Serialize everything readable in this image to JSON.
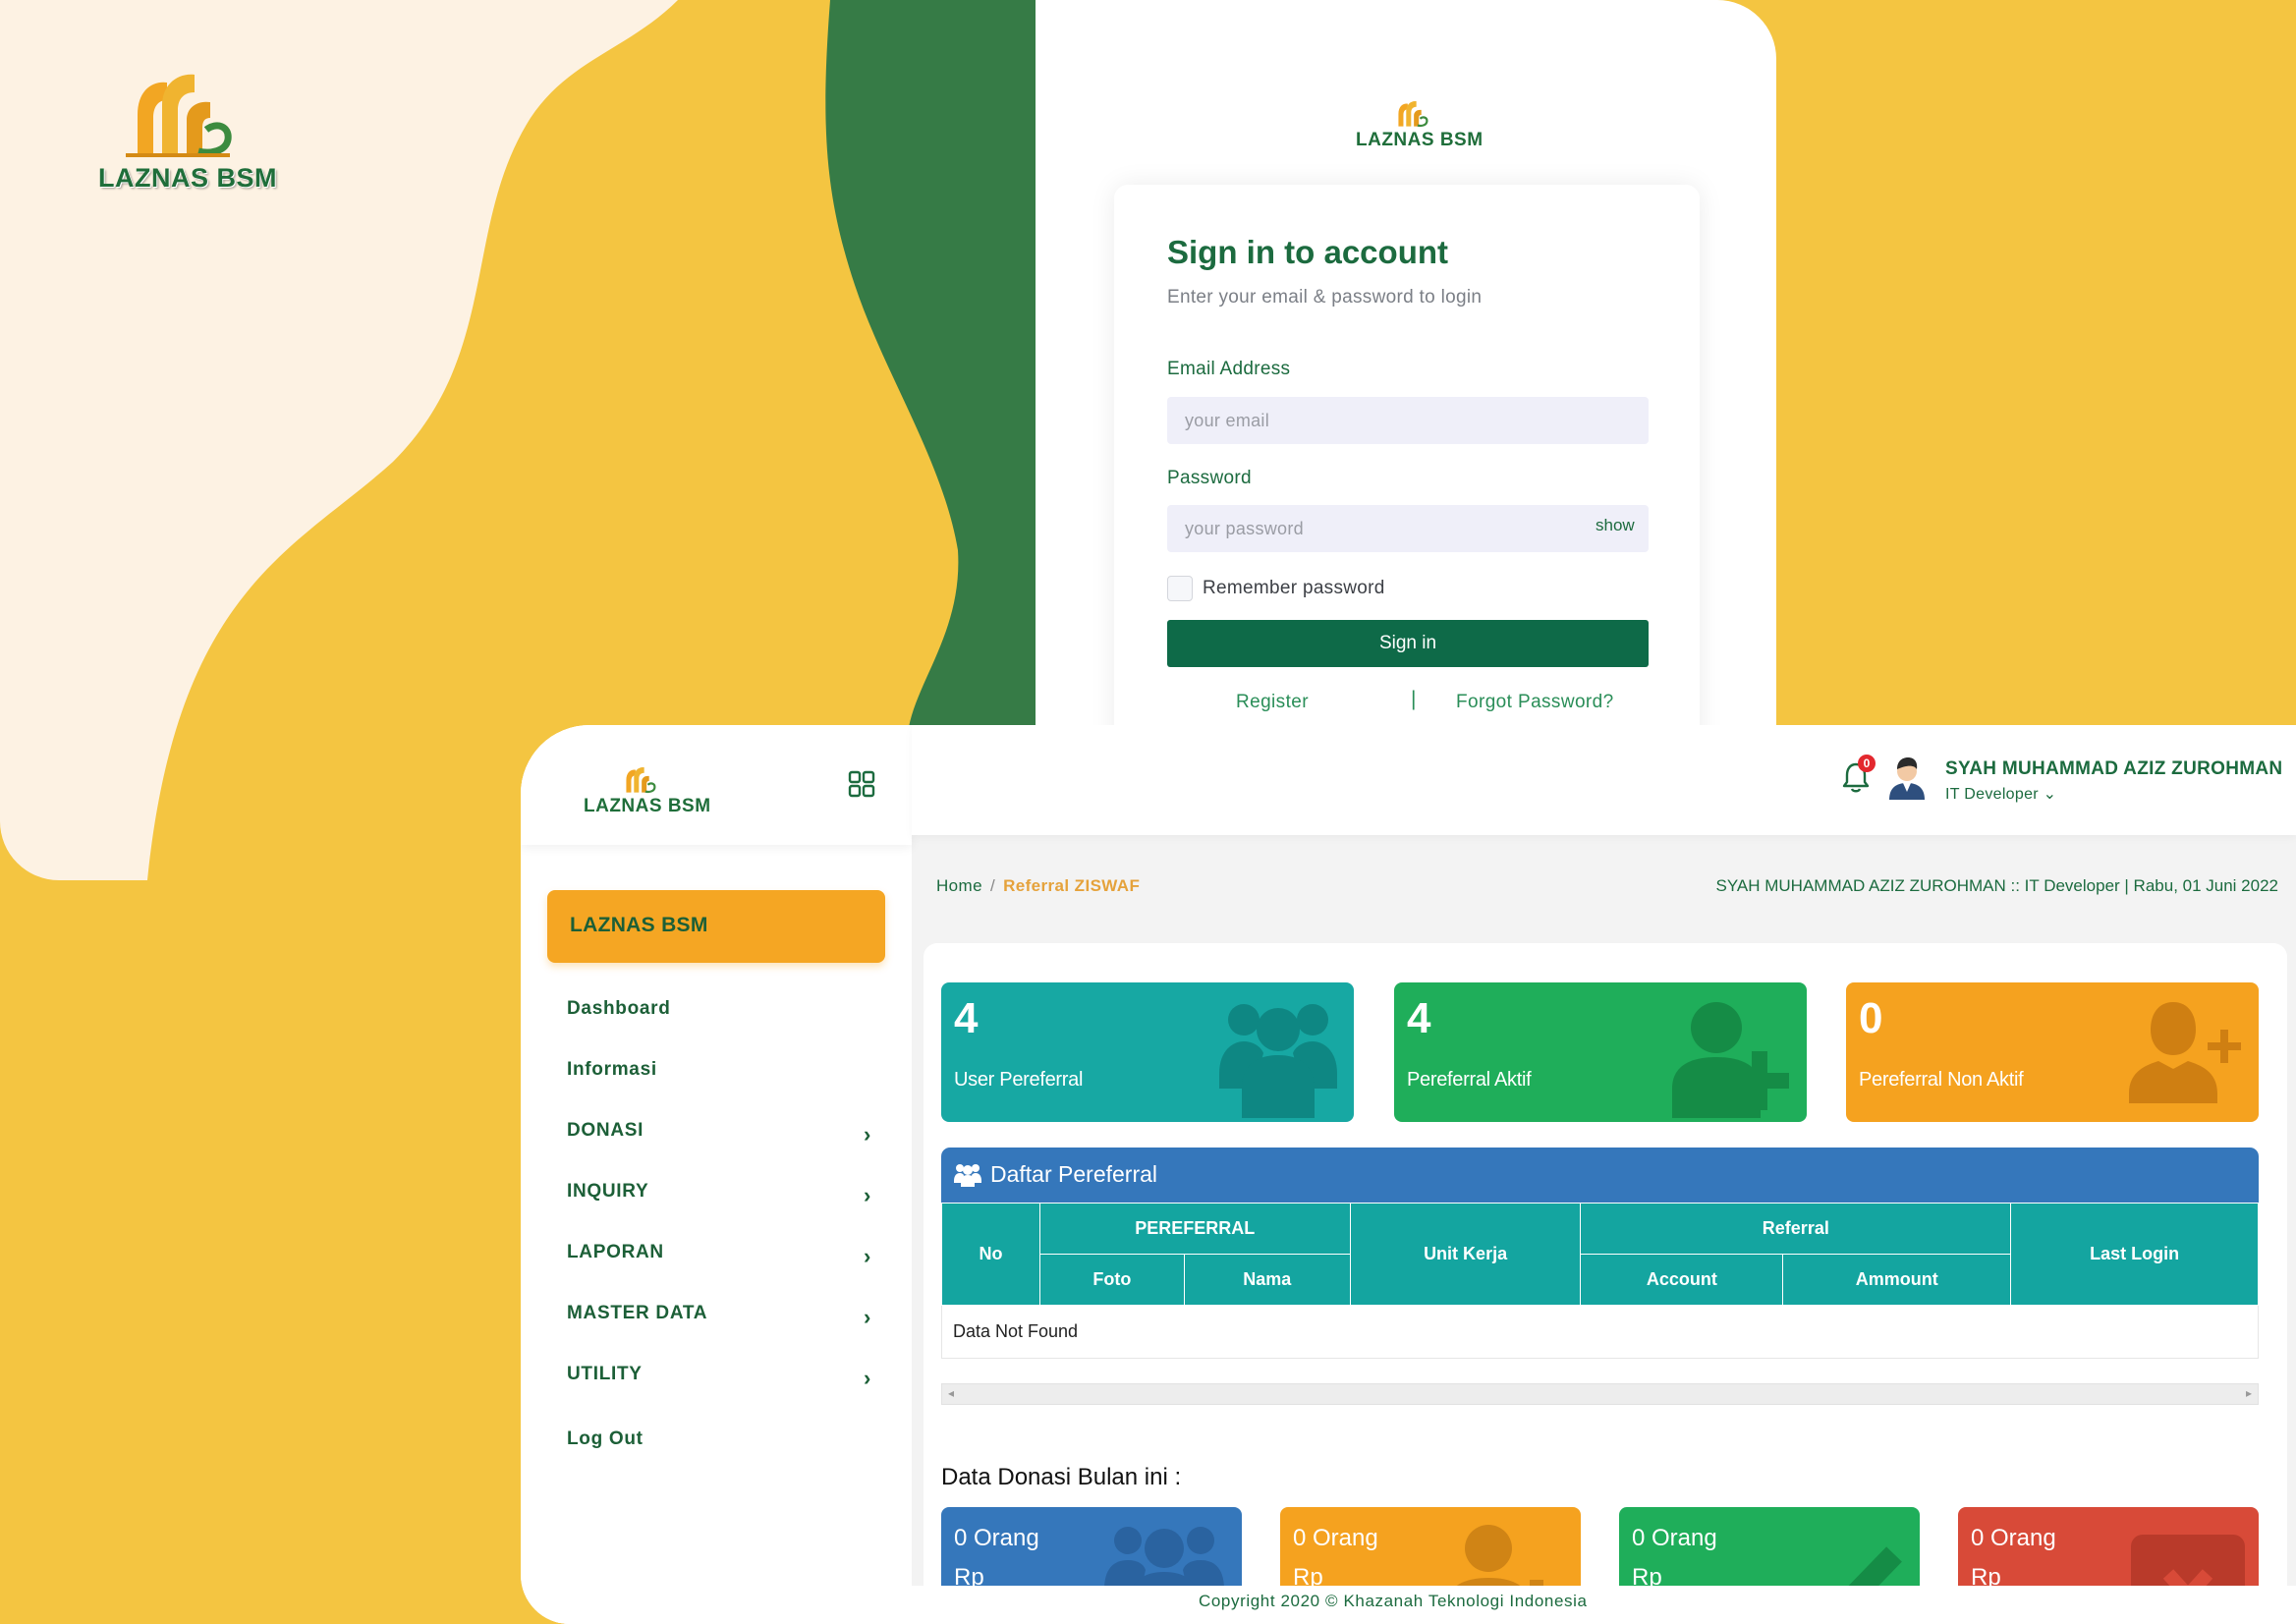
{
  "colors": {
    "background_yellow": "#F4C541",
    "cream": "#FDF2E3",
    "dark_green": "#367B46",
    "brand_green": "#0E6A48",
    "orange": "#F5A623",
    "teal": "#14A5A0",
    "blue": "#3577BB",
    "green_tile": "#1FAE5A",
    "red_tile": "#D84A38"
  },
  "login": {
    "logo_text": "LAZNAS BSM",
    "title": "Sign in to account",
    "subtitle": "Enter your email & password to login",
    "email_label": "Email Address",
    "email_placeholder": "your email",
    "password_label": "Password",
    "password_placeholder": "your password",
    "show_label": "show",
    "remember_label": "Remember password",
    "signin_label": "Sign in",
    "register_label": "Register",
    "separator": "|",
    "forgot_label": "Forgot Password?"
  },
  "sidebar": {
    "logo_text": "LAZNAS BSM",
    "toggle_icon": "grid-icon",
    "brand": "LAZNAS BSM",
    "items": [
      {
        "label": "Dashboard",
        "has_submenu": false
      },
      {
        "label": "Informasi",
        "has_submenu": false
      },
      {
        "label": "DONASI",
        "has_submenu": true
      },
      {
        "label": "INQUIRY",
        "has_submenu": true
      },
      {
        "label": "LAPORAN",
        "has_submenu": true
      },
      {
        "label": "MASTER DATA",
        "has_submenu": true
      },
      {
        "label": "UTILITY",
        "has_submenu": true
      },
      {
        "label": "Log Out",
        "has_submenu": false
      }
    ],
    "chevron": "›"
  },
  "topbar": {
    "notification_count": "0",
    "user_name": "SYAH MUHAMMAD AZIZ ZUROHMAN",
    "user_role": "IT Developer ⌄"
  },
  "breadcrumb": {
    "home": "Home",
    "separator": "/",
    "current": "Referral ZISWAF"
  },
  "session_info": "SYAH MUHAMMAD AZIZ ZUROHMAN :: IT Developer | Rabu, 01 Juni 2022",
  "stats": [
    {
      "value": "4",
      "label": "User Pereferral",
      "icon": "users-icon",
      "color": "#17A8A3"
    },
    {
      "value": "4",
      "label": "Pereferral Aktif",
      "icon": "user-plus-icon",
      "color": "#1FAE5A"
    },
    {
      "value": "0",
      "label": "Pereferral Non Aktif",
      "icon": "user-plus-icon",
      "color": "#F5A21F"
    }
  ],
  "referral_list": {
    "title": "Daftar Pereferral",
    "icon": "users-icon",
    "headers": {
      "no": "No",
      "pereferral": "PEREFERRAL",
      "foto": "Foto",
      "nama": "Nama",
      "unit_kerja": "Unit Kerja",
      "referral": "Referral",
      "account": "Account",
      "ammount": "Ammount",
      "last_login": "Last Login"
    },
    "empty_text": "Data Not Found"
  },
  "donasi": {
    "title": "Data Donasi Bulan ini :",
    "tiles": [
      {
        "label": "0 Orang",
        "sub": "Rp",
        "icon": "users-icon",
        "color": "#3577BB"
      },
      {
        "label": "0 Orang",
        "sub": "Rp",
        "icon": "user-plus-icon",
        "color": "#F5A21F"
      },
      {
        "label": "0 Orang",
        "sub": "Rp",
        "icon": "check-icon",
        "color": "#1FAE5A"
      },
      {
        "label": "0 Orang",
        "sub": "Rp",
        "icon": "close-icon",
        "color": "#D84A38"
      }
    ]
  },
  "footer": {
    "copyright": "Copyright 2020 © Khazanah Teknologi Indonesia"
  }
}
